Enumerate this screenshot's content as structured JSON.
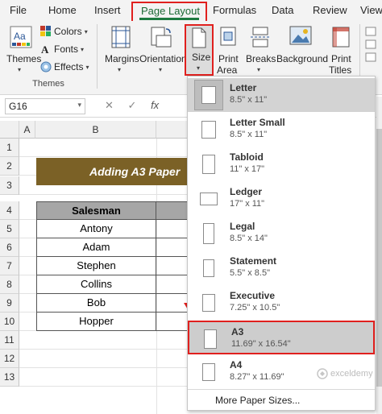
{
  "ribbon_tabs": [
    "File",
    "Home",
    "Insert",
    "Page Layout",
    "Formulas",
    "Data",
    "Review",
    "View"
  ],
  "ribbon": {
    "themes_label": "Themes",
    "colors_label": "Colors",
    "fonts_label": "Fonts",
    "effects_label": "Effects",
    "group_themes": "Themes",
    "margins_label": "Margins",
    "orientation_label": "Orientation",
    "size_label": "Size",
    "print_area_line1": "Print",
    "print_area_line2": "Area",
    "breaks_label": "Breaks",
    "background_label": "Background",
    "print_titles_line1": "Print",
    "print_titles_line2": "Titles"
  },
  "formula_bar": {
    "name_box": "G16",
    "cancel": "✕",
    "enter": "✓",
    "fx": "fx"
  },
  "columns": [
    "A",
    "B"
  ],
  "rows": [
    "1",
    "2",
    "3",
    "4",
    "5",
    "6",
    "7",
    "8",
    "9",
    "10",
    "11",
    "12",
    "13"
  ],
  "sheet": {
    "title": "Adding A3 Paper",
    "header": "Salesman",
    "salesmen": [
      "Antony",
      "Adam",
      "Stephen",
      "Collins",
      "Bob",
      "Hopper"
    ]
  },
  "paper_sizes": [
    {
      "name": "Letter",
      "dims": "8.5\" x 11\""
    },
    {
      "name": "Letter Small",
      "dims": "8.5\" x 11\""
    },
    {
      "name": "Tabloid",
      "dims": "11\" x 17\""
    },
    {
      "name": "Ledger",
      "dims": "17\" x 11\""
    },
    {
      "name": "Legal",
      "dims": "8.5\" x 14\""
    },
    {
      "name": "Statement",
      "dims": "5.5\" x 8.5\""
    },
    {
      "name": "Executive",
      "dims": "7.25\" x 10.5\""
    },
    {
      "name": "A3",
      "dims": "11.69\" x 16.54\""
    },
    {
      "name": "A4",
      "dims": "8.27\" x 11.69\""
    }
  ],
  "more_sizes": "More Paper Sizes...",
  "watermark": "exceldemy",
  "colors": {
    "highlight_red": "#e0201e",
    "title_fill": "#7b6126",
    "header_fill": "#a6a6a6",
    "excel_green": "#1d7a40"
  }
}
